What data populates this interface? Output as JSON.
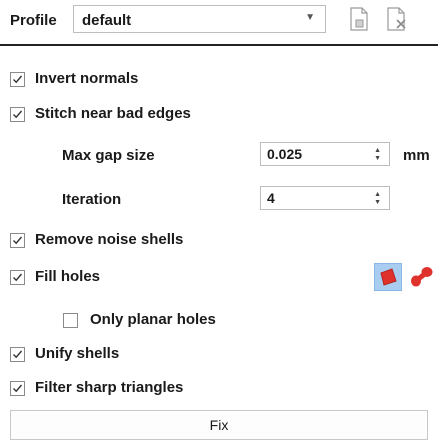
{
  "profile": {
    "label": "Profile",
    "value": "default"
  },
  "options": {
    "invert_normals": {
      "label": "Invert normals",
      "checked": true
    },
    "stitch_bad_edges": {
      "label": "Stitch near bad edges",
      "checked": true
    },
    "max_gap": {
      "label": "Max gap size",
      "value": "0.025",
      "unit": "mm"
    },
    "iteration": {
      "label": "Iteration",
      "value": "4"
    },
    "remove_noise": {
      "label": "Remove noise shells",
      "checked": true
    },
    "fill_holes": {
      "label": "Fill holes",
      "checked": true
    },
    "only_planar": {
      "label": "Only planar holes",
      "checked": false
    },
    "unify_shells": {
      "label": "Unify shells",
      "checked": true
    },
    "filter_sharp": {
      "label": "Filter sharp triangles",
      "checked": true
    }
  },
  "fix_label": "Fix",
  "colors": {
    "accent_red": "#e0322d",
    "selected_bg": "#a8cdf0"
  }
}
